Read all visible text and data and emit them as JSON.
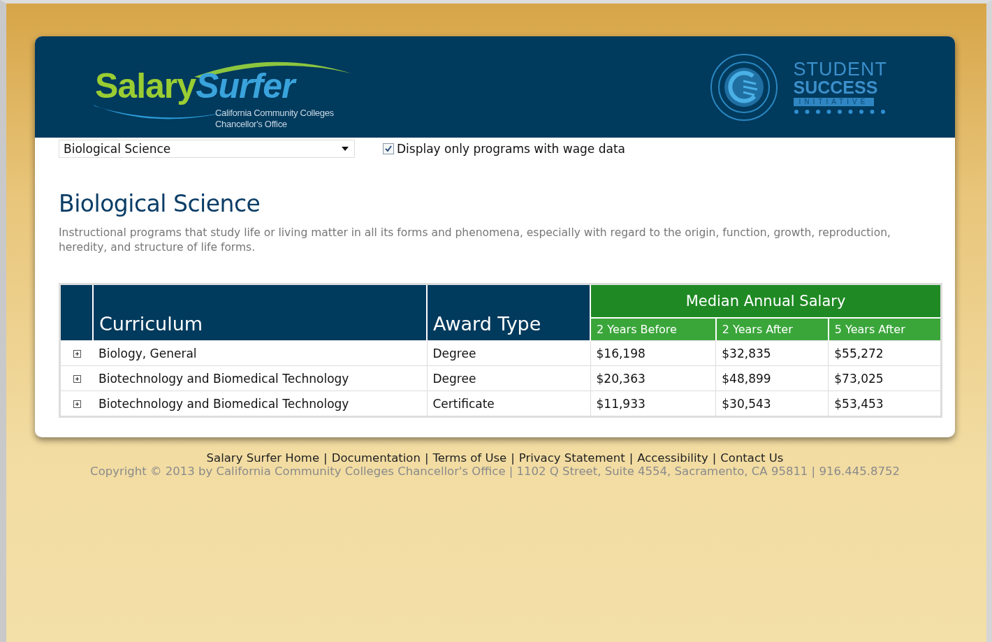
{
  "header": {
    "logo": {
      "word_1": "Salary",
      "word_2": "Surfer",
      "subtitle_lines": [
        "California Community Colleges",
        "Chancellor's Office"
      ]
    },
    "initiative": {
      "line_1": "STUDENT",
      "line_2": "SUCCESS",
      "line_3": "INITIATIVE"
    }
  },
  "controls": {
    "program_select": {
      "value": "Biological Science"
    },
    "wage_filter": {
      "label": "Display only programs with wage data",
      "checked": true
    }
  },
  "program": {
    "title": "Biological Science",
    "description": "Instructional programs that study life or living matter in all its forms and phenomena, especially with regard to the origin, function, growth, reproduction, heredity, and structure of life forms."
  },
  "table": {
    "columns": [
      "Curriculum",
      "Award Type"
    ],
    "group_header": "Median Annual Salary",
    "salary_columns": [
      "2 Years Before",
      "2 Years After",
      "5 Years After"
    ],
    "rows": [
      {
        "curriculum": "Biology, General",
        "award_type": "Degree",
        "salaries": [
          "$16,198",
          "$32,835",
          "$55,272"
        ],
        "expanded": false
      },
      {
        "curriculum": "Biotechnology and Biomedical Technology",
        "award_type": "Degree",
        "salaries": [
          "$20,363",
          "$48,899",
          "$73,025"
        ],
        "expanded": false
      },
      {
        "curriculum": "Biotechnology and Biomedical Technology",
        "award_type": "Certificate",
        "salaries": [
          "$11,933",
          "$30,543",
          "$53,453"
        ],
        "expanded": false
      }
    ]
  },
  "footer": {
    "links": [
      "Salary Surfer Home",
      "Documentation",
      "Terms of Use",
      "Privacy Statement",
      "Accessibility",
      "Contact Us"
    ],
    "separator": "|",
    "copyright": "Copyright © 2013 by California Community Colleges Chancellor's Office | 1102 Q Street, Suite 4554, Sacramento, CA 95811 | 916.445.8752"
  }
}
